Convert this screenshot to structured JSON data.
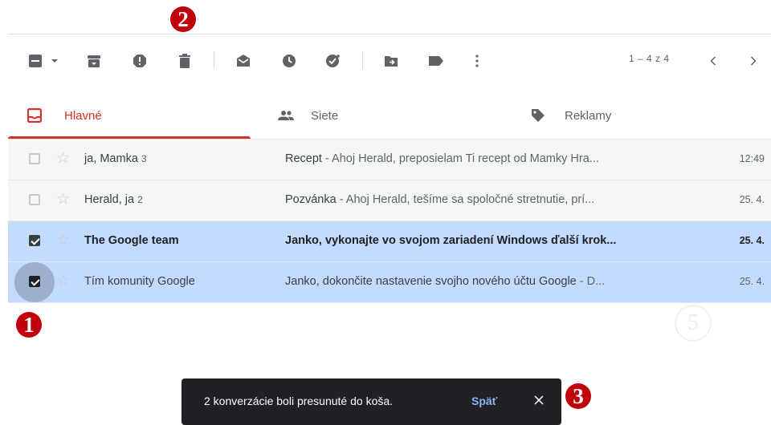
{
  "toolbar": {
    "icons": [
      "select-all-checkbox-icon",
      "select-dropdown-icon",
      "archive-icon",
      "report-spam-icon",
      "delete-icon",
      "mark-as-read-icon",
      "snooze-icon",
      "add-to-tasks-icon",
      "move-to-icon",
      "labels-icon",
      "more-icon"
    ],
    "pager": "1 – 4 z 4"
  },
  "tabs": [
    {
      "label": "Hlavné",
      "icon": "inbox-icon",
      "active": true
    },
    {
      "label": "Siete",
      "icon": "people-icon",
      "active": false
    },
    {
      "label": "Reklamy",
      "icon": "tag-icon",
      "active": false
    }
  ],
  "rows": [
    {
      "sender": "ja, Mamka",
      "count": "3",
      "subject": "Recept",
      "snippet": " - Ahoj Herald, preposielam Ti recept od Mamky Hra...",
      "date": "12:49",
      "selected": false,
      "unread": false
    },
    {
      "sender": "Herald, ja",
      "count": "2",
      "subject": "Pozvánka",
      "snippet": " - Ahoj Herald, tešíme sa spoločné stretnutie, prí...",
      "date": "25. 4.",
      "selected": false,
      "unread": false
    },
    {
      "sender": "The Google team",
      "count": "",
      "subject": "Janko, vykonajte vo svojom zariadení Windows ďalší krok...",
      "snippet": "",
      "date": "25. 4.",
      "selected": true,
      "unread": true
    },
    {
      "sender": "Tím komunity Google",
      "count": "",
      "subject": "Janko, dokončite nastavenie svojho nového účtu Google",
      "snippet": " - D...",
      "date": "25. 4.",
      "selected": true,
      "unread": false
    }
  ],
  "markers": {
    "one": "1",
    "two": "2",
    "three": "3",
    "five": "5"
  },
  "snackbar": {
    "message": "2 konverzácie boli presunuté do koša.",
    "undo": "Späť",
    "close_icon": "close-icon"
  },
  "colors": {
    "accent": "#d93025",
    "selected_row": "#c2dbff",
    "marker": "#c0000b",
    "snackbar": "#202124",
    "undo": "#8ab4f8"
  }
}
